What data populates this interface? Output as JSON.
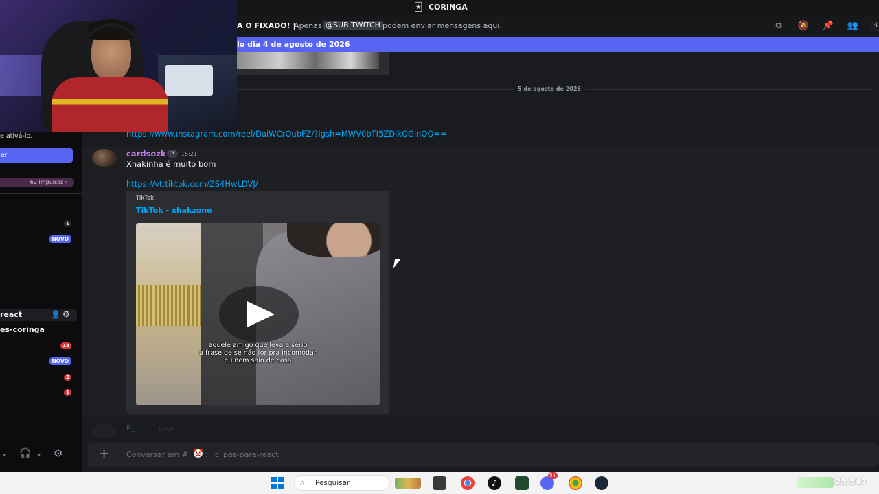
{
  "header": {
    "channel_title": "CORINGA",
    "pinned_notice": "A O FIXADO! |",
    "pinned_restriction_prefix": "Apenas",
    "pinned_role": "@SUB TWITCH",
    "pinned_restriction_suffix": "podem enviar mensagens aqui.",
    "banner_text": "lo dia 4 de agosto de 2026",
    "cut_right_label": "B"
  },
  "sidebar": {
    "activate_text": "e ativá-lo.",
    "blue_button_label": "er",
    "boost_label": "62 Impulsos",
    "category_label": "react",
    "channel_name": "es-coringa",
    "badges": [
      "1",
      "NOVO",
      "18",
      "NOVO",
      "2",
      "1"
    ]
  },
  "chat": {
    "date_divider": "5 de agosto de 2026",
    "instagram_link": "https://www.instagram.com/reel/DaiWCrOubFZ/?igsh=MWV0bTI5ZDlkOGlnOQ==",
    "message": {
      "author": "cardsozk",
      "badge": "CK",
      "timestamp": "15:21",
      "text": "Xhakinha é muito bom",
      "link": "https://vt.tiktok.com/ZS4HwLDVJ/",
      "embed": {
        "provider": "TikTok",
        "title": "TikTok - xhakzone",
        "caption_lines": [
          "aquele amigo que leva a sério",
          "a frase de se não for pra incomodar",
          "eu nem saio de casa"
        ]
      }
    },
    "next_author_partial": "R_",
    "next_timestamp_partial": "17:00"
  },
  "composer": {
    "placeholder_prefix": "Conversar em #",
    "channel": "clipes-para-react"
  },
  "taskbar": {
    "search_label": "Pesquisar",
    "discord_badge": "9+",
    "tray_text": "25.547"
  },
  "colors": {
    "accent": "#5865f2",
    "link": "#00a8fc",
    "author": "#c27ee8",
    "badge_red": "#da373c"
  }
}
